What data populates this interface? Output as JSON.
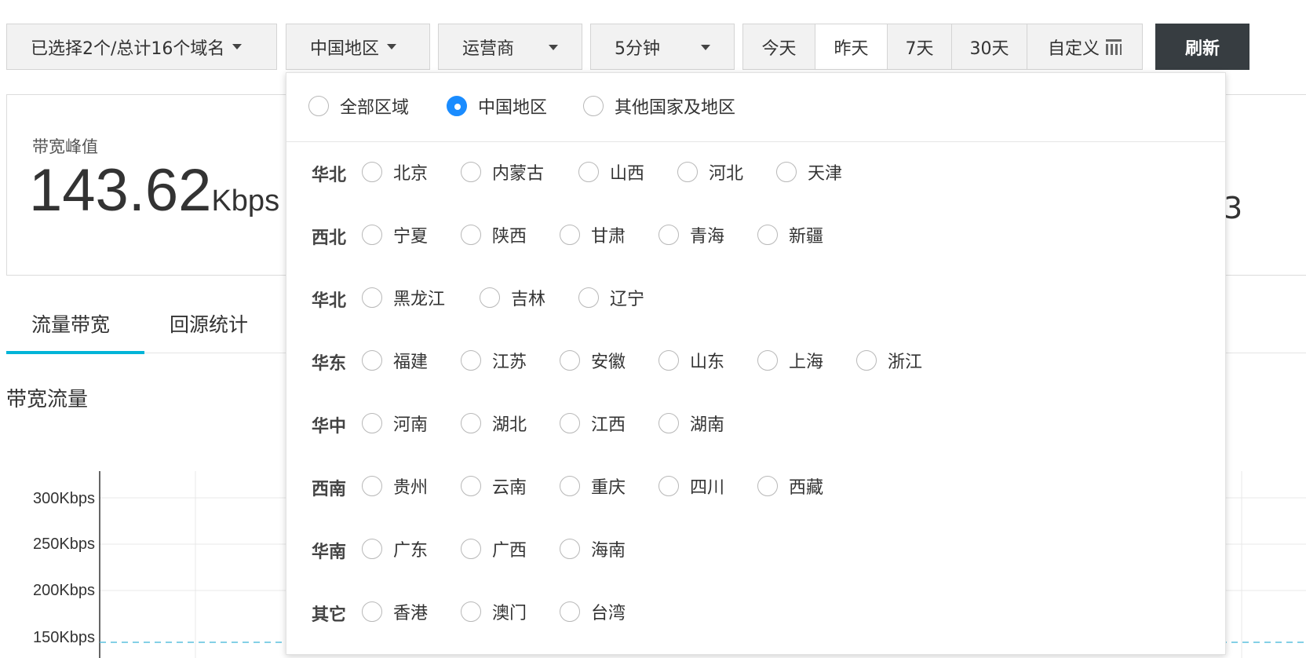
{
  "toolbar": {
    "domain_label": "已选择2个/总计16个域名",
    "region_label": "中国地区",
    "isp_label": "运营商",
    "granularity_label": "5分钟",
    "dates": [
      "今天",
      "昨天",
      "7天",
      "30天",
      "自定义"
    ],
    "active_date": "昨天",
    "refresh_label": "刷新"
  },
  "stat": {
    "label": "带宽峰值",
    "value": "143.62",
    "unit": "Kbps",
    "right_fragment": "3"
  },
  "tabs": [
    "流量带宽",
    "回源统计"
  ],
  "active_tab": "流量带宽",
  "section_title": "带宽流量",
  "region_dropdown": {
    "scopes": [
      "全部区域",
      "中国地区",
      "其他国家及地区"
    ],
    "selected_scope": "中国地区",
    "groups": [
      {
        "name": "华北",
        "regions": [
          "北京",
          "内蒙古",
          "山西",
          "河北",
          "天津"
        ]
      },
      {
        "name": "西北",
        "regions": [
          "宁夏",
          "陕西",
          "甘肃",
          "青海",
          "新疆"
        ]
      },
      {
        "name": "华北",
        "regions": [
          "黑龙江",
          "吉林",
          "辽宁"
        ]
      },
      {
        "name": "华东",
        "regions": [
          "福建",
          "江苏",
          "安徽",
          "山东",
          "上海",
          "浙江"
        ]
      },
      {
        "name": "华中",
        "regions": [
          "河南",
          "湖北",
          "江西",
          "湖南"
        ]
      },
      {
        "name": "西南",
        "regions": [
          "贵州",
          "云南",
          "重庆",
          "四川",
          "西藏"
        ]
      },
      {
        "name": "华南",
        "regions": [
          "广东",
          "广西",
          "海南"
        ]
      },
      {
        "name": "其它",
        "regions": [
          "香港",
          "澳门",
          "台湾"
        ]
      }
    ]
  },
  "chart": {
    "y_ticks": [
      "300Kbps",
      "250Kbps",
      "200Kbps",
      "150Kbps"
    ],
    "series_color": "#5bc0de"
  },
  "colors": {
    "accent": "#00b4d8",
    "radio_checked": "#1a8cff",
    "refresh_bg": "#373d41"
  }
}
